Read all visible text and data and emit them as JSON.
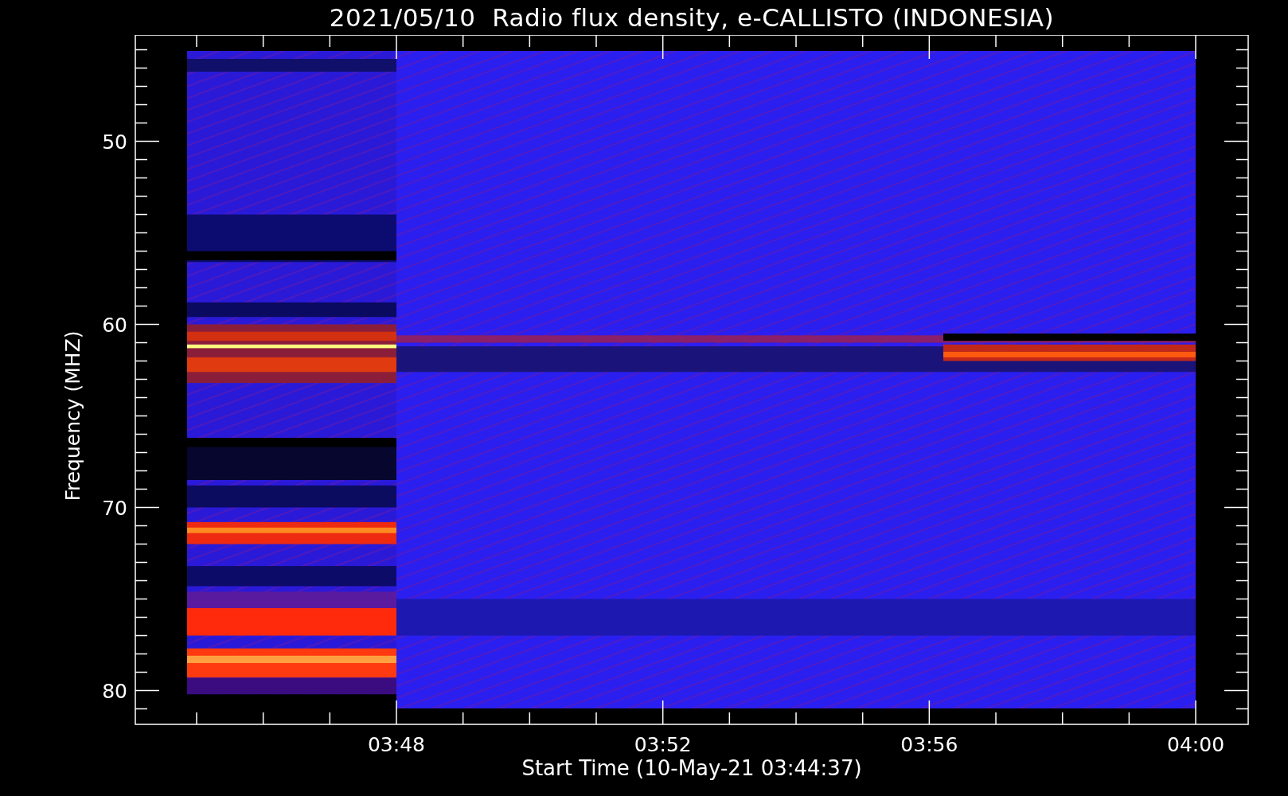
{
  "title": "2021/05/10  Radio flux density, e-CALLISTO (INDONESIA)",
  "y_axis": {
    "label": "Frequency (MHZ)",
    "ticks": [
      "50",
      "60",
      "70",
      "80"
    ]
  },
  "x_axis": {
    "label": "Start Time (10-May-21 03:44:37)",
    "ticks": [
      "03:48",
      "03:52",
      "03:56",
      "04:00"
    ]
  }
}
